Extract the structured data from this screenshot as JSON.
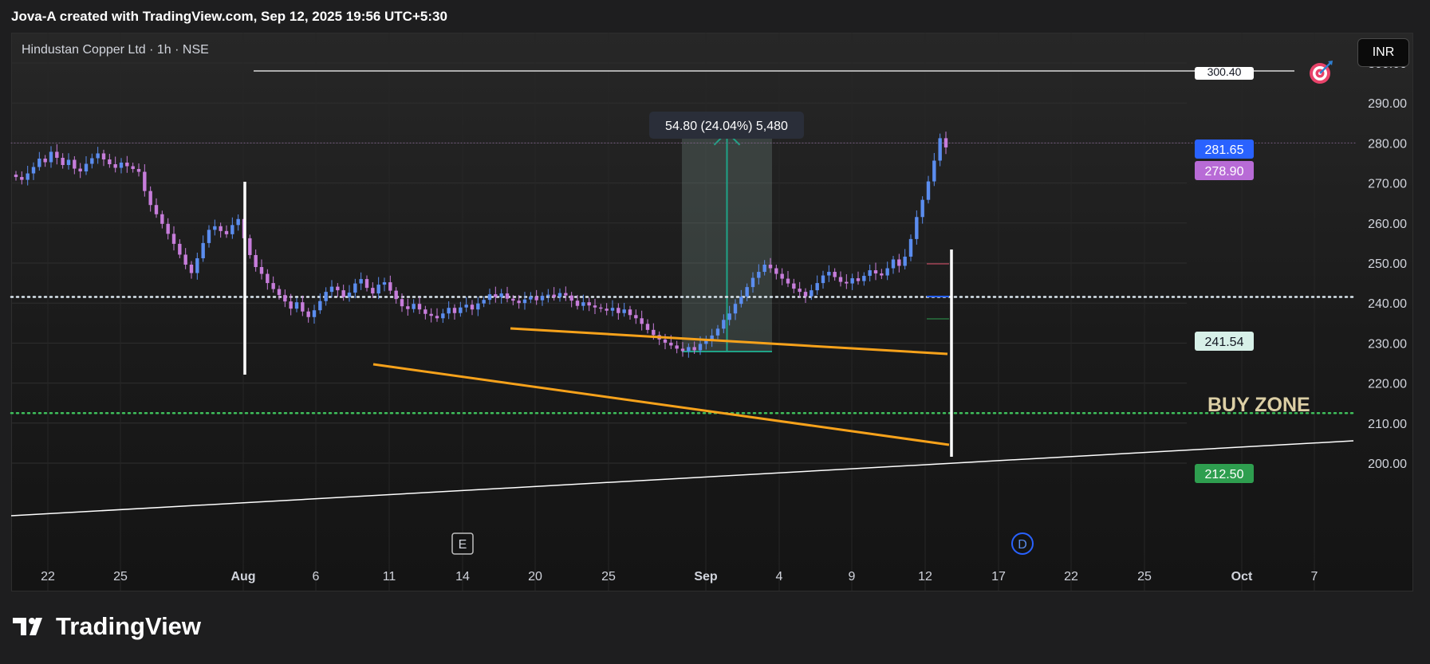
{
  "header": {
    "text": "Jova-A created with TradingView.com, Sep 12, 2025 19:56 UTC+5:30"
  },
  "symbol": {
    "title": "Hindustan Copper Ltd · 1h · NSE"
  },
  "currency": "INR",
  "brand": {
    "name": "TradingView"
  },
  "icons": {
    "target": "target-icon",
    "brand_logo": "tradingview-logo-icon"
  },
  "colors": {
    "up_candle": "#5b8def",
    "down_candle": "#c77ddb",
    "trendline": "#f7a21b",
    "measure": "#1fa387",
    "marker": "#ffffff",
    "dotted_white": "#dbe7ef",
    "dotted_green": "#3fbf5c"
  },
  "chart_data": {
    "type": "candlestick",
    "y_axis": {
      "ticks": [
        200,
        210,
        220,
        230,
        240,
        250,
        260,
        270,
        280,
        290,
        300
      ]
    },
    "x_axis": {
      "ticks": [
        "22",
        "25",
        "Aug",
        "6",
        "11",
        "14",
        "20",
        "25",
        "Sep",
        "4",
        "9",
        "12",
        "17",
        "22",
        "25",
        "Oct",
        "7"
      ]
    },
    "price_labels": [
      {
        "text": "281.65",
        "value": 281.65,
        "bg": "#2962ff",
        "fg": "#ffffff"
      },
      {
        "text": "278.90",
        "value": 278.9,
        "bg": "#b86bd6",
        "fg": "#ffffff"
      },
      {
        "text": "241.54",
        "value": 241.54,
        "bg": "#d7f0e8",
        "fg": "#131722"
      },
      {
        "text": "212.50",
        "value": 212.5,
        "bg": "#2e9e4f",
        "fg": "#ffffff"
      },
      {
        "text": "300.40",
        "value": 300.4,
        "bg": "#ffffff",
        "fg": "#131722"
      }
    ],
    "horizontal_lines": [
      {
        "value": 241.54,
        "style": "dotted",
        "color": "#dbe7ef"
      },
      {
        "value": 212.5,
        "style": "dotted",
        "color": "#3fbf5c"
      },
      {
        "value": 280.0,
        "style": "dotted-faint",
        "color": "#7b5f86"
      }
    ],
    "measure": {
      "label": "54.80 (24.04%) 5,480",
      "from_value": 227.9,
      "to_value": 282.7,
      "start_x": "Aug 28",
      "end_x": "Sep 4"
    },
    "annotation": {
      "text": "BUY ZONE",
      "color": "#dccfa5"
    },
    "event_markers": [
      {
        "label": "E",
        "x": "Aug 13"
      },
      {
        "label": "D",
        "x": "Sep 18"
      }
    ],
    "candles_close": [
      271.5,
      270.8,
      272.4,
      274.0,
      276.1,
      275.2,
      277.8,
      276.3,
      274.5,
      275.8,
      273.6,
      272.9,
      274.8,
      276.2,
      277.4,
      275.9,
      274.7,
      273.8,
      275.1,
      274.2,
      273.5,
      272.8,
      268.0,
      264.5,
      262.2,
      259.8,
      257.3,
      254.8,
      252.1,
      249.6,
      247.5,
      251.2,
      255.0,
      258.3,
      259.2,
      258.0,
      257.2,
      259.5,
      261.0,
      256.2,
      252.0,
      249.0,
      247.3,
      245.0,
      243.5,
      242.0,
      240.4,
      238.6,
      240.2,
      237.9,
      236.5,
      238.2,
      240.5,
      242.8,
      244.1,
      243.2,
      241.5,
      242.6,
      244.9,
      246.0,
      243.8,
      242.4,
      244.6,
      245.2,
      243.1,
      241.0,
      239.2,
      238.5,
      239.8,
      238.4,
      237.3,
      236.8,
      236.2,
      237.4,
      238.8,
      237.5,
      238.9,
      239.6,
      238.4,
      239.9,
      240.8,
      242.2,
      241.5,
      242.4,
      241.1,
      240.6,
      240.0,
      240.9,
      241.6,
      240.7,
      241.8,
      242.1,
      241.5,
      242.5,
      241.9,
      240.6,
      239.3,
      240.2,
      239.4,
      238.9,
      238.6,
      238.1,
      238.8,
      237.5,
      238.4,
      237.0,
      236.2,
      234.8,
      233.3,
      232.0,
      230.9,
      230.1,
      229.4,
      228.6,
      228.0,
      229.0,
      228.2,
      229.8,
      230.7,
      231.9,
      233.6,
      235.8,
      237.4,
      239.8,
      241.6,
      244.0,
      246.3,
      247.8,
      249.6,
      248.7,
      247.3,
      246.1,
      244.9,
      243.6,
      242.8,
      241.7,
      243.2,
      245.0,
      246.9,
      247.8,
      246.5,
      245.3,
      244.9,
      246.2,
      245.5,
      246.8,
      248.2,
      247.4,
      246.9,
      248.7,
      250.9,
      249.3,
      251.6,
      256.0,
      261.5,
      265.8,
      270.4,
      275.6,
      281.2,
      278.9
    ]
  }
}
